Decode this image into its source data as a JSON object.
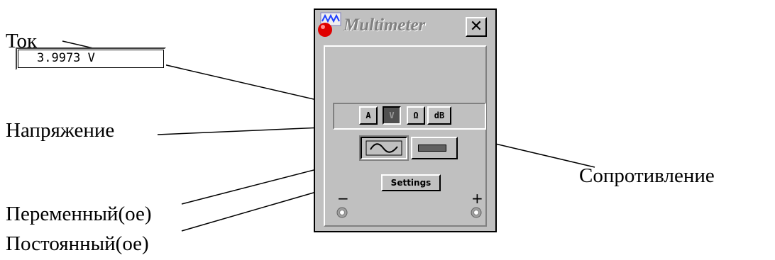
{
  "callouts": {
    "current": "Ток",
    "voltage": "Напряжение",
    "resistance": "Сопротивление",
    "alternating": "Переменный(ое)",
    "direct": "Постоянный(ое)"
  },
  "multimeter": {
    "title": "Multimeter",
    "close_label": "✕",
    "display_value": "3.9973 V",
    "modes": [
      {
        "label": "A",
        "selected": false
      },
      {
        "label": "V",
        "selected": true
      },
      {
        "label": "Ω",
        "selected": false
      },
      {
        "label": "dB",
        "selected": false
      }
    ],
    "signal": {
      "ac_selected": false,
      "dc_selected": true
    },
    "settings_label": "Settings",
    "terminals": {
      "negative": "−",
      "positive": "+"
    }
  }
}
